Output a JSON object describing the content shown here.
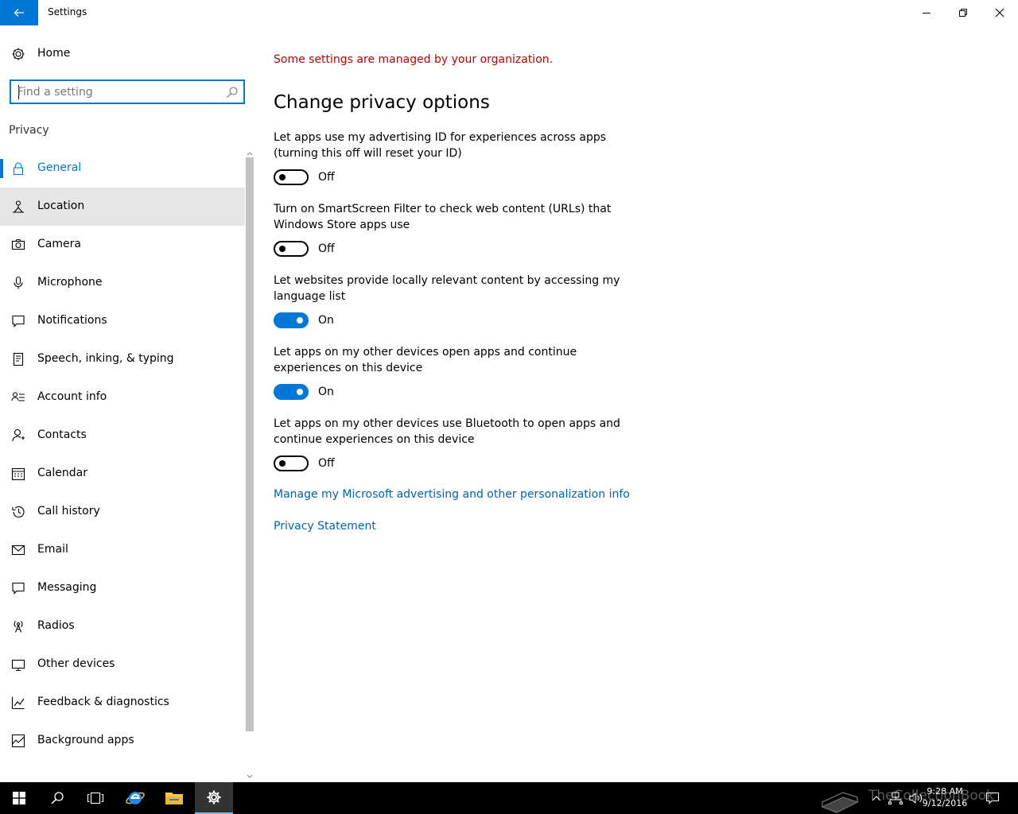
{
  "window": {
    "title": "Settings",
    "minimize_icon": "minimize-icon",
    "maximize_icon": "restore-icon",
    "close_icon": "close-icon"
  },
  "sidebar": {
    "home_label": "Home",
    "search_placeholder": "Find a setting",
    "section_label": "Privacy",
    "items": [
      {
        "label": "General",
        "icon": "lock-icon",
        "state": "selected"
      },
      {
        "label": "Location",
        "icon": "location-icon",
        "state": "hovered"
      },
      {
        "label": "Camera",
        "icon": "camera-icon"
      },
      {
        "label": "Microphone",
        "icon": "microphone-icon"
      },
      {
        "label": "Notifications",
        "icon": "notifications-icon"
      },
      {
        "label": "Speech, inking, & typing",
        "icon": "speech-icon"
      },
      {
        "label": "Account info",
        "icon": "account-info-icon"
      },
      {
        "label": "Contacts",
        "icon": "contacts-icon"
      },
      {
        "label": "Calendar",
        "icon": "calendar-icon"
      },
      {
        "label": "Call history",
        "icon": "call-history-icon"
      },
      {
        "label": "Email",
        "icon": "email-icon"
      },
      {
        "label": "Messaging",
        "icon": "messaging-icon"
      },
      {
        "label": "Radios",
        "icon": "radios-icon"
      },
      {
        "label": "Other devices",
        "icon": "other-devices-icon"
      },
      {
        "label": "Feedback & diagnostics",
        "icon": "feedback-icon"
      },
      {
        "label": "Background apps",
        "icon": "background-apps-icon"
      }
    ]
  },
  "main": {
    "org_message": "Some settings are managed by your organization.",
    "title": "Change privacy options",
    "settings": [
      {
        "description": "Let apps use my advertising ID for experiences across apps (turning this off will reset your ID)",
        "state": "Off"
      },
      {
        "description": "Turn on SmartScreen Filter to check web content (URLs) that Windows Store apps use",
        "state": "Off"
      },
      {
        "description": "Let websites provide locally relevant content by accessing my language list",
        "state": "On"
      },
      {
        "description": "Let apps on my other devices open apps and continue experiences on this device",
        "state": "On"
      },
      {
        "description": "Let apps on my other devices use Bluetooth to open apps and continue experiences on this device",
        "state": "Off"
      }
    ],
    "links": {
      "manage_ads": "Manage my Microsoft advertising and other personalization info",
      "privacy_statement": "Privacy Statement"
    }
  },
  "taskbar": {
    "time": "9:28 AM",
    "date": "9/12/2016",
    "watermark": "TheCollectionBook"
  },
  "colors": {
    "accent": "#0078d7",
    "link": "#0063b1",
    "warning": "#c00000"
  }
}
